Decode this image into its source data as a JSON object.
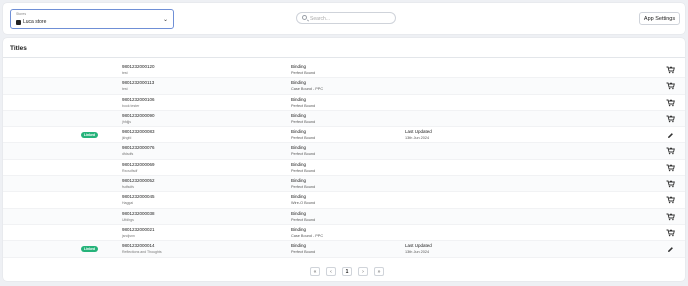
{
  "header": {
    "store_select": {
      "caption": "Stores",
      "value": "Luca store"
    },
    "search": {
      "placeholder": "Search..."
    },
    "settings_label": "App Settings"
  },
  "titles": {
    "heading": "Titles",
    "rows": [
      {
        "isbn": "9801232000120",
        "subtitle": "test",
        "binding_label": "Binding",
        "binding_value": "Perfect Bound",
        "linked": false,
        "linked_label": "",
        "updated_label": "",
        "updated_value": ""
      },
      {
        "isbn": "9801232000113",
        "subtitle": "test",
        "binding_label": "Binding",
        "binding_value": "Case Bound - PPC",
        "linked": false,
        "linked_label": "",
        "updated_label": "",
        "updated_value": ""
      },
      {
        "isbn": "9801232000106",
        "subtitle": "book tester",
        "binding_label": "Binding",
        "binding_value": "Perfect Bound",
        "linked": false,
        "linked_label": "",
        "updated_label": "",
        "updated_value": ""
      },
      {
        "isbn": "9801232000090",
        "subtitle": "jhfdjjs",
        "binding_label": "Binding",
        "binding_value": "Perfect Bound",
        "linked": false,
        "linked_label": "",
        "updated_label": "",
        "updated_value": ""
      },
      {
        "isbn": "9801232000083",
        "subtitle": "jkhgfd",
        "binding_label": "Binding",
        "binding_value": "Perfect Bound",
        "linked": true,
        "linked_label": "Linked",
        "updated_label": "Last Updated",
        "updated_value": "13th Jun 2024"
      },
      {
        "isbn": "9801232000076",
        "subtitle": "dfdsdfs",
        "binding_label": "Binding",
        "binding_value": "Perfect Bound",
        "linked": false,
        "linked_label": "",
        "updated_label": "",
        "updated_value": ""
      },
      {
        "isbn": "9801232000069",
        "subtitle": "Rxcsdfsdf",
        "binding_label": "Binding",
        "binding_value": "Perfect Bound",
        "linked": false,
        "linked_label": "",
        "updated_label": "",
        "updated_value": ""
      },
      {
        "isbn": "9801232000052",
        "subtitle": "fsdfsdfs",
        "binding_label": "Binding",
        "binding_value": "Perfect Bound",
        "linked": false,
        "linked_label": "",
        "updated_label": "",
        "updated_value": ""
      },
      {
        "isbn": "9801232000045",
        "subtitle": "Haggai",
        "binding_label": "Binding",
        "binding_value": "Wire-O Bound",
        "linked": false,
        "linked_label": "",
        "updated_label": "",
        "updated_value": ""
      },
      {
        "isbn": "9801232000038",
        "subtitle": "Uifdhgs",
        "binding_label": "Binding",
        "binding_value": "Perfect Bound",
        "linked": false,
        "linked_label": "",
        "updated_label": "",
        "updated_value": ""
      },
      {
        "isbn": "9801232000021",
        "subtitle": "jsndjsnn",
        "binding_label": "Binding",
        "binding_value": "Case Bound - PPC",
        "linked": false,
        "linked_label": "",
        "updated_label": "",
        "updated_value": ""
      },
      {
        "isbn": "9801232000014",
        "subtitle": "Reflections and Thoughts",
        "binding_label": "Binding",
        "binding_value": "Perfect Bound",
        "linked": true,
        "linked_label": "Linked",
        "updated_label": "Last Updated",
        "updated_value": "13th Jun 2024"
      }
    ]
  },
  "pagination": {
    "first": "«",
    "prev": "‹",
    "current_page": "1",
    "next": "›",
    "last": "»"
  },
  "icons": {
    "unlinked_row_action": "cart-add-icon",
    "linked_row_action": "pencil-edit-icon",
    "store": "store-icon",
    "search": "search-icon",
    "dropdown": "chevron-down-icon"
  },
  "colors": {
    "linked_badge": "#25b37a",
    "select_border": "#6f8fd6"
  }
}
